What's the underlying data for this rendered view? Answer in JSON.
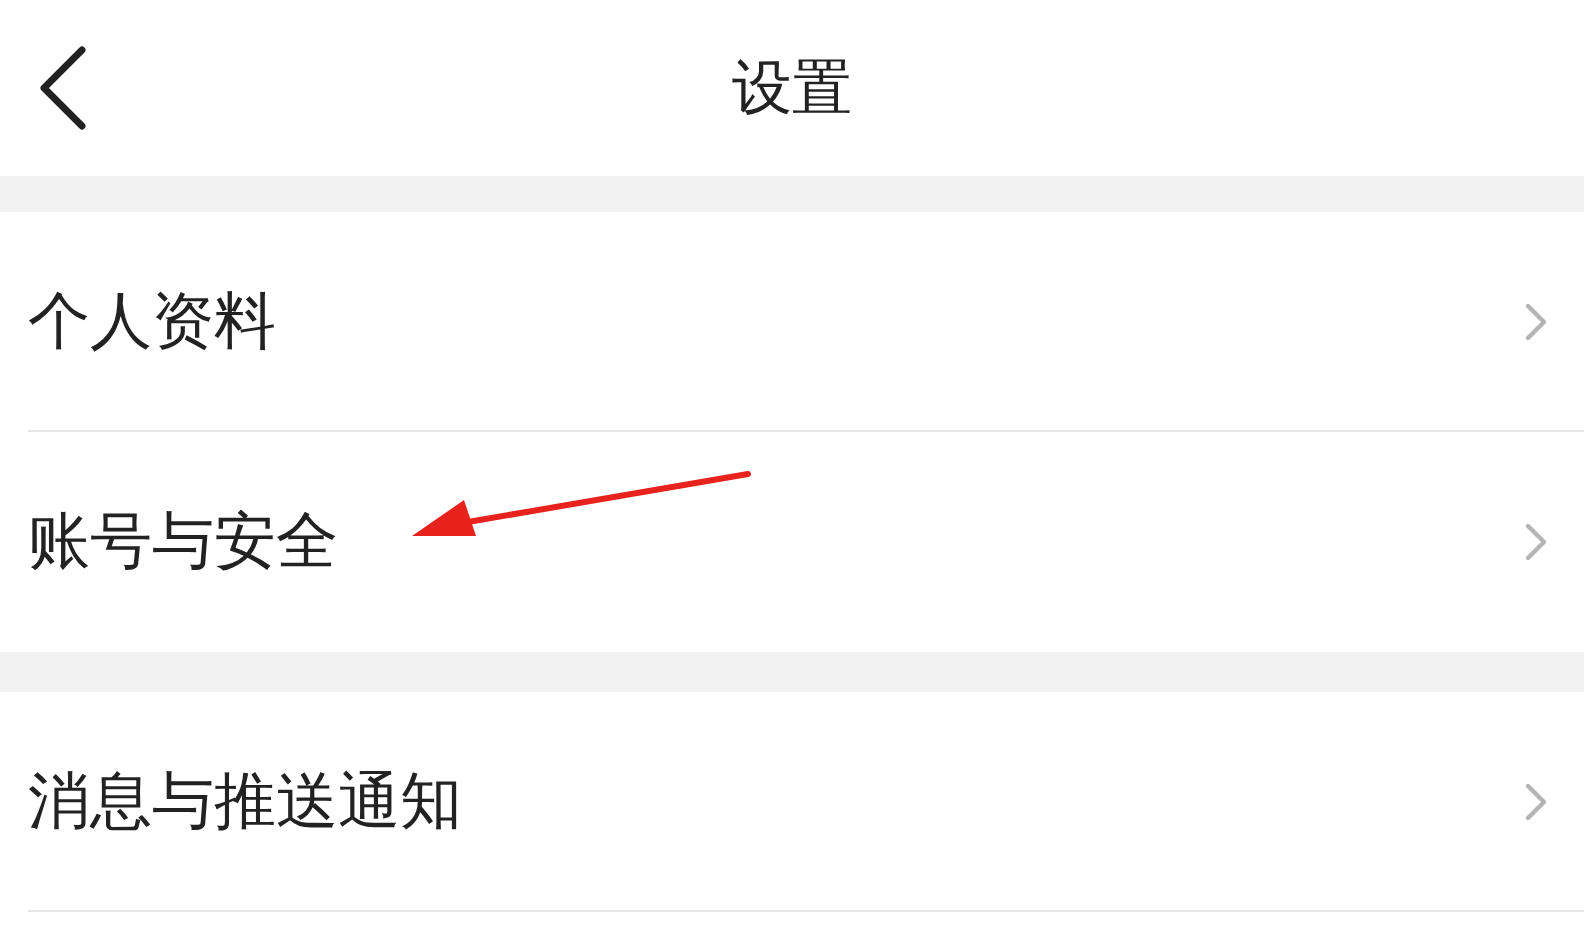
{
  "header": {
    "title": "设置"
  },
  "sections": [
    {
      "items": [
        {
          "label": "个人资料",
          "pointed": false
        },
        {
          "label": "账号与安全",
          "pointed": true
        }
      ]
    },
    {
      "items": [
        {
          "label": "消息与推送通知",
          "pointed": false
        }
      ]
    }
  ]
}
